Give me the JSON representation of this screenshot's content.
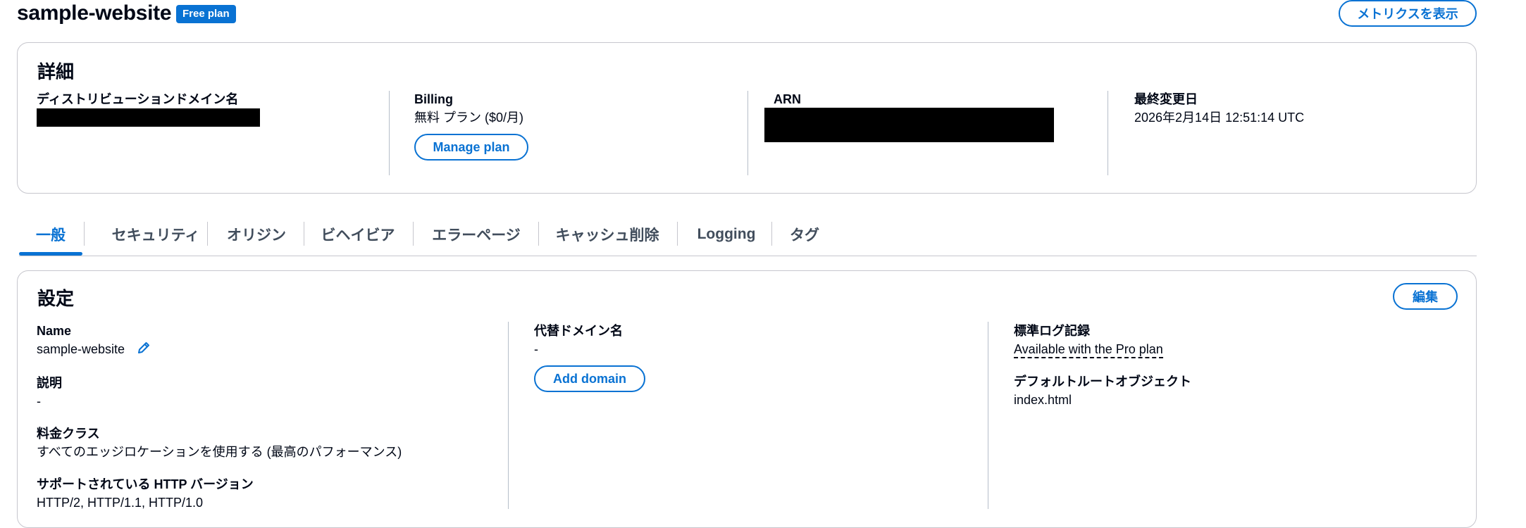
{
  "header": {
    "title": "sample-website",
    "badge": "Free plan",
    "metrics_button": "メトリクスを表示"
  },
  "details": {
    "title": "詳細",
    "domain_label": "ディストリビューションドメイン名",
    "billing_label": "Billing",
    "billing_value": "無料 プラン ($0/月)",
    "manage_plan_button": "Manage plan",
    "arn_label": "ARN",
    "modified_label": "最終変更日",
    "modified_value": "2026年2月14日 12:51:14 UTC"
  },
  "tabs": [
    {
      "label": "一般",
      "active": true
    },
    {
      "label": "セキュリティ"
    },
    {
      "label": "オリジン"
    },
    {
      "label": "ビヘイビア"
    },
    {
      "label": "エラーページ"
    },
    {
      "label": "キャッシュ削除"
    },
    {
      "label": "Logging"
    },
    {
      "label": "タグ"
    }
  ],
  "settings": {
    "title": "設定",
    "edit_button": "編集",
    "name_label": "Name",
    "name_value": "sample-website",
    "description_label": "説明",
    "description_value": "-",
    "price_class_label": "料金クラス",
    "price_class_value": "すべてのエッジロケーションを使用する (最高のパフォーマンス)",
    "http_label": "サポートされている HTTP バージョン",
    "http_value": "HTTP/2, HTTP/1.1, HTTP/1.0",
    "alt_domain_label": "代替ドメイン名",
    "alt_domain_value": "-",
    "add_domain_button": "Add domain",
    "std_log_label": "標準ログ記録",
    "std_log_value": "Available with the Pro plan",
    "default_root_label": "デフォルトルートオブジェクト",
    "default_root_value": "index.html"
  },
  "colors": {
    "accent": "#0972d3",
    "text": "#000716",
    "border": "#c6c6cd"
  },
  "icons": {
    "edit_name": "pencil-icon"
  }
}
